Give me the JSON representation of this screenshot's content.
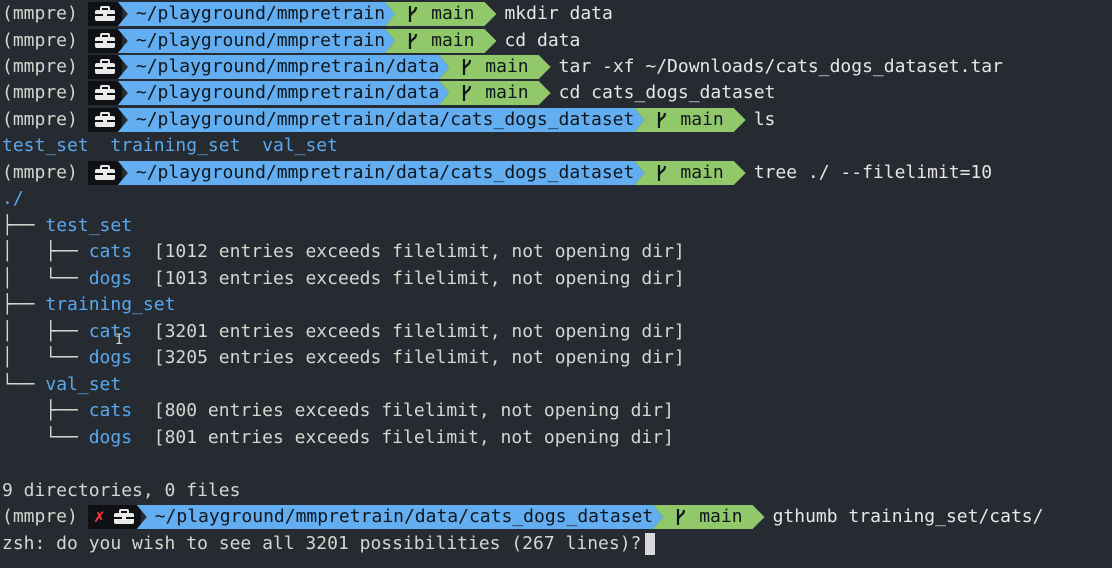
{
  "prompt": {
    "env": "(mmpre)",
    "branch": "main",
    "fail_mark": "✗",
    "os_icon": "briefcase-icon",
    "branch_icon": "git-branch-icon"
  },
  "colors": {
    "background": "#262a31",
    "path_segment": "#63aef1",
    "git_segment": "#91c86a",
    "os_segment": "#101114",
    "dir_text": "#5aa9ee"
  },
  "lines": {
    "l1": {
      "path": "~/playground/mmpretrain",
      "cmd": "mkdir data"
    },
    "l2": {
      "path": "~/playground/mmpretrain",
      "cmd": "cd data"
    },
    "l3": {
      "path": "~/playground/mmpretrain/data",
      "cmd": "tar -xf ~/Downloads/cats_dogs_dataset.tar"
    },
    "l4": {
      "path": "~/playground/mmpretrain/data",
      "cmd": "cd cats_dogs_dataset"
    },
    "l5": {
      "path": "~/playground/mmpretrain/data/cats_dogs_dataset",
      "cmd": "ls"
    },
    "ls_output": [
      "test_set",
      "training_set",
      "val_set"
    ],
    "l6": {
      "path": "~/playground/mmpretrain/data/cats_dogs_dataset",
      "cmd": "tree ./ --filelimit=10"
    },
    "tree_root": "./",
    "tree": {
      "test_set": {
        "name": "test_set",
        "cats": "cats",
        "cats_note": "[1012 entries exceeds filelimit, not opening dir]",
        "dogs": "dogs",
        "dogs_note": "[1013 entries exceeds filelimit, not opening dir]"
      },
      "training_set": {
        "name": "training_set",
        "cats": "cats",
        "cats_note": "[3201 entries exceeds filelimit, not opening dir]",
        "dogs": "dogs",
        "dogs_note": "[3205 entries exceeds filelimit, not opening dir]"
      },
      "val_set": {
        "name": "val_set",
        "cats": "cats",
        "cats_note": "[800 entries exceeds filelimit, not opening dir]",
        "dogs": "dogs",
        "dogs_note": "[801 entries exceeds filelimit, not opening dir]"
      }
    },
    "summary": "9 directories, 0 files",
    "l7": {
      "path": "~/playground/mmpretrain/data/cats_dogs_dataset",
      "cmd": "gthumb training_set/cats/"
    },
    "zsh_prompt": "zsh: do you wish to see all 3201 possibilities (267 lines)?"
  }
}
